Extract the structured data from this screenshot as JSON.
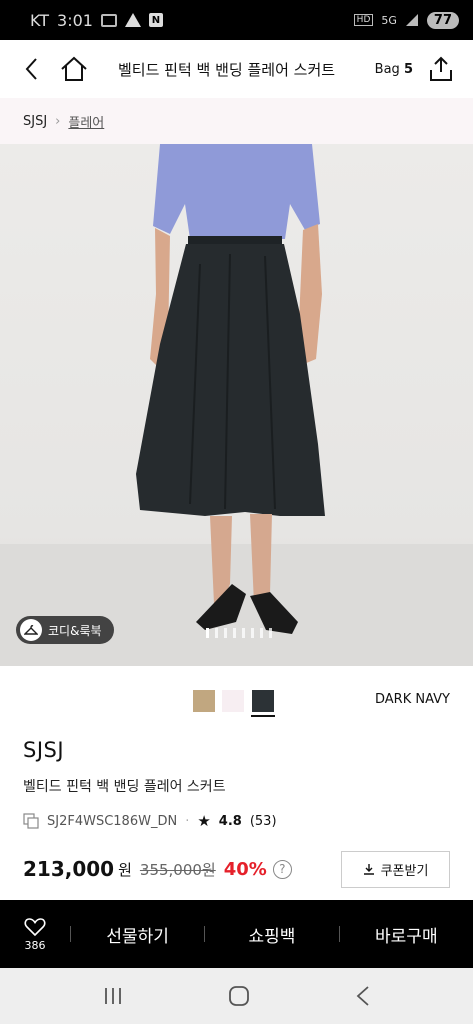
{
  "status": {
    "carrier": "KT",
    "time": "3:01",
    "network": "5G",
    "battery": "77"
  },
  "nav": {
    "title": "벨티드 핀턱 백 밴딩 플레어 스커트",
    "bag_label": "Bag",
    "bag_count": "5"
  },
  "breadcrumb": {
    "brand": "SJSJ",
    "category": "플레어"
  },
  "hero": {
    "coordi_label": "코디&룩북",
    "slide_count": 8,
    "active_slide": 0
  },
  "colors": {
    "options": [
      {
        "hex": "#c1a780"
      },
      {
        "hex": "#f7eef2"
      },
      {
        "hex": "#2c3236"
      }
    ],
    "selected_index": 2,
    "selected_name": "DARK NAVY"
  },
  "product": {
    "brand": "SJSJ",
    "name": "벨티드 핀턱 백 밴딩 플레어 스커트",
    "code": "SJ2F4WSC186W_DN",
    "rating": "4.8",
    "review_count": "(53)",
    "price": "213,000",
    "currency": "원",
    "original_price": "355,000원",
    "discount": "40%",
    "coupon_label": "쿠폰받기"
  },
  "bottom": {
    "like_count": "386",
    "gift": "선물하기",
    "cart": "쇼핑백",
    "buy": "바로구매"
  }
}
